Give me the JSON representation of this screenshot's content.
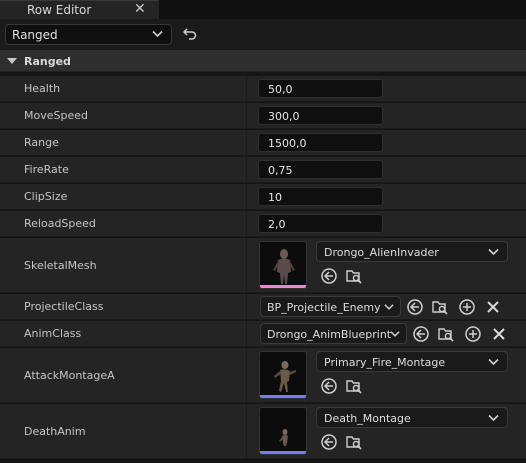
{
  "tab": {
    "title": "Row Editor",
    "close": "✕"
  },
  "toolbar": {
    "row_name": "Ranged"
  },
  "category": {
    "label": "Ranged"
  },
  "properties": {
    "health": {
      "label": "Health",
      "value": "50,0"
    },
    "movespeed": {
      "label": "MoveSpeed",
      "value": "300,0"
    },
    "range": {
      "label": "Range",
      "value": "1500,0"
    },
    "firerate": {
      "label": "FireRate",
      "value": "0,75"
    },
    "clipsize": {
      "label": "ClipSize",
      "value": "10"
    },
    "reloadspeed": {
      "label": "ReloadSpeed",
      "value": "2,0"
    },
    "skeletalmesh": {
      "label": "SkeletalMesh",
      "asset": "Drongo_AlienInvader",
      "bar_color": "#e88bd0"
    },
    "projectileclass": {
      "label": "ProjectileClass",
      "asset": "BP_Projectile_Enemy"
    },
    "animclass": {
      "label": "AnimClass",
      "asset": "Drongo_AnimBlueprint"
    },
    "attackmontagea": {
      "label": "AttackMontageA",
      "asset": "Primary_Fire_Montage",
      "bar_color": "#7b7bf0"
    },
    "deathanim": {
      "label": "DeathAnim",
      "asset": "Death_Montage",
      "bar_color": "#7b7bf0"
    }
  },
  "icons": {
    "use_selected": "arrow-left-circle-icon",
    "browse": "folder-search-icon",
    "add": "plus-circle-icon",
    "clear": "x-icon",
    "reset": "undo-arrow-icon"
  }
}
